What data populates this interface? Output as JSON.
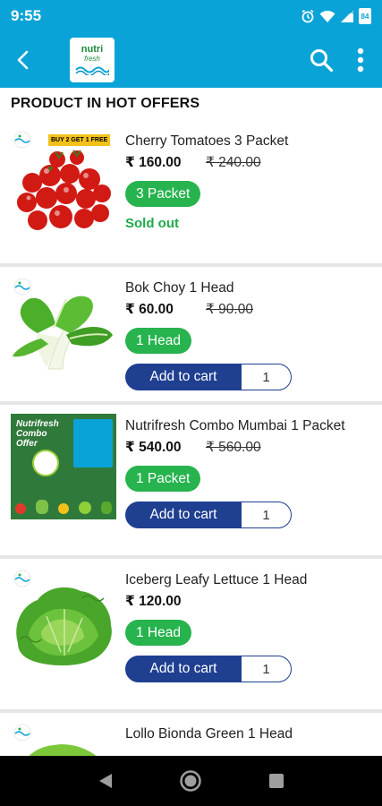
{
  "status_bar": {
    "time": "9:55",
    "battery": "84"
  },
  "app_bar": {
    "logo_line1": "nutri",
    "logo_line2": "fresh",
    "colors": {
      "primary": "#0aa3d8"
    }
  },
  "section": {
    "title": "PRODUCT IN HOT OFFERS"
  },
  "products": [
    {
      "name": "Cherry Tomatoes 3 Packet",
      "price": "₹ 160.00",
      "mrp": "₹ 240.00",
      "variant": "3 Packet",
      "status": "Sold out",
      "badge": "BUY 2 GET 1 FREE",
      "image_icon": "tomato-image"
    },
    {
      "name": "Bok Choy 1 Head",
      "price": "₹ 60.00",
      "mrp": "₹ 90.00",
      "variant": "1 Head",
      "cart_label": "Add to cart",
      "qty": "1",
      "image_icon": "bok-choy-image"
    },
    {
      "name": "Nutrifresh Combo Mumbai 1 Packet",
      "price": "₹ 540.00",
      "mrp": "₹ 560.00",
      "variant": "1 Packet",
      "cart_label": "Add to cart",
      "qty": "1",
      "image_icon": "combo-offer-image",
      "image_title": "Nutrifresh Combo Offer"
    },
    {
      "name": "Iceberg Leafy Lettuce 1 Head",
      "price": "₹ 120.00",
      "variant": "1 Head",
      "cart_label": "Add to cart",
      "qty": "1",
      "image_icon": "lettuce-image"
    },
    {
      "name": "Lollo Bionda Green 1 Head",
      "image_icon": "lollo-bionda-image"
    }
  ]
}
